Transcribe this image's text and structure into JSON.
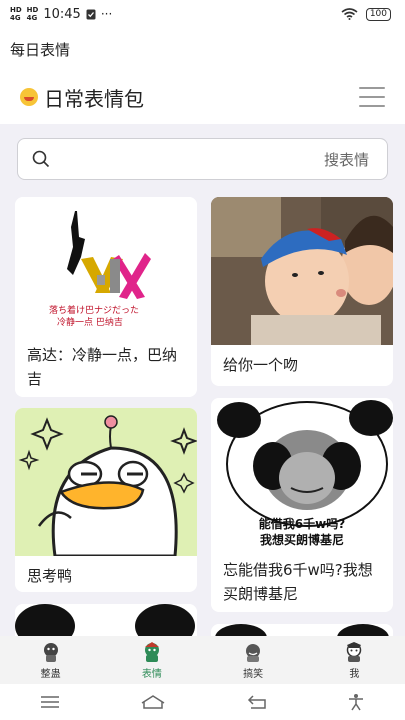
{
  "status_bar": {
    "net1": "4G",
    "net1_sub": "HD",
    "net2": "4G",
    "net2_sub": "HD",
    "time": "10:45",
    "dots": "···",
    "battery": "100"
  },
  "app_title": "每日表情",
  "header": {
    "title": "日常表情包"
  },
  "search": {
    "placeholder": "搜表情"
  },
  "cards": [
    {
      "caption": "高达：冷静一点，巴纳吉",
      "art_text_1": "落ち着け巴ナジだった",
      "art_text_2": "冷静一点 巴纳吉"
    },
    {
      "caption": "给你一个吻"
    },
    {
      "caption": "思考鸭"
    },
    {
      "caption": "忘能借我6千w吗?我想买朗博基尼",
      "art_text_1": "能借我6千w吗?",
      "art_text_2": "我想买朗博基尼"
    }
  ],
  "bottom_nav": [
    {
      "label": "整蛊"
    },
    {
      "label": "表情"
    },
    {
      "label": "搞笑"
    },
    {
      "label": "我"
    }
  ],
  "colors": {
    "active_tab": "#2e8b57",
    "background": "#f1f0f6"
  }
}
